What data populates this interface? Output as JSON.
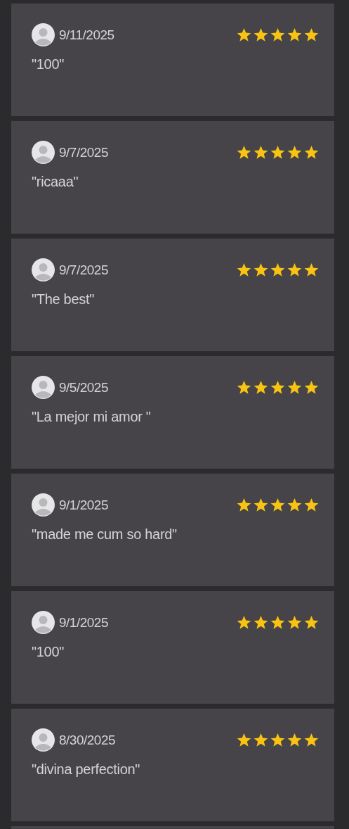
{
  "reviews": [
    {
      "date": "9/11/2025",
      "stars": 5,
      "text": "\"100\""
    },
    {
      "date": "9/7/2025",
      "stars": 5,
      "text": "\"ricaaa\""
    },
    {
      "date": "9/7/2025",
      "stars": 5,
      "text": "\"The best\""
    },
    {
      "date": "9/5/2025",
      "stars": 5,
      "text": "\"La mejor mi amor \""
    },
    {
      "date": "9/1/2025",
      "stars": 5,
      "text": "\"made me cum so hard\""
    },
    {
      "date": "9/1/2025",
      "stars": 5,
      "text": "\"100\""
    },
    {
      "date": "8/30/2025",
      "stars": 5,
      "text": "\"divina perfection\""
    }
  ]
}
